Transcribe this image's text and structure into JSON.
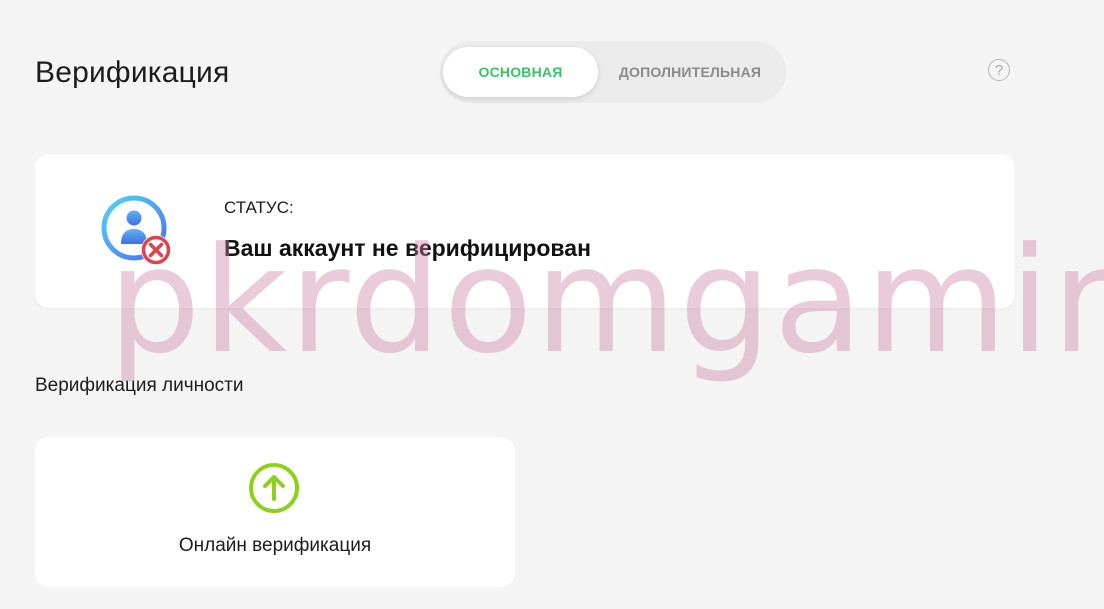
{
  "header": {
    "title": "Верификация",
    "tabs": [
      {
        "label": "ОСНОВНАЯ",
        "active": true
      },
      {
        "label": "ДОПОЛНИТЕЛЬНАЯ",
        "active": false
      }
    ],
    "help_symbol": "?"
  },
  "status_card": {
    "icon": "user-unverified-icon",
    "label": "СТАТУС:",
    "value": "Ваш аккаунт не верифицирован"
  },
  "identity_section": {
    "title": "Верификация личности",
    "options": [
      {
        "label": "Онлайн верификация",
        "icon": "upload-arrow-icon"
      }
    ]
  },
  "watermark": {
    "text": "pkrdomgaming"
  },
  "colors": {
    "background": "#f4f4f4",
    "accent_green": "#3fbf6a",
    "upload_green": "#8ed11c",
    "error_red": "#e0424e",
    "avatar_blue": "#4a8cf0",
    "watermark_pink": "#d98aae"
  }
}
